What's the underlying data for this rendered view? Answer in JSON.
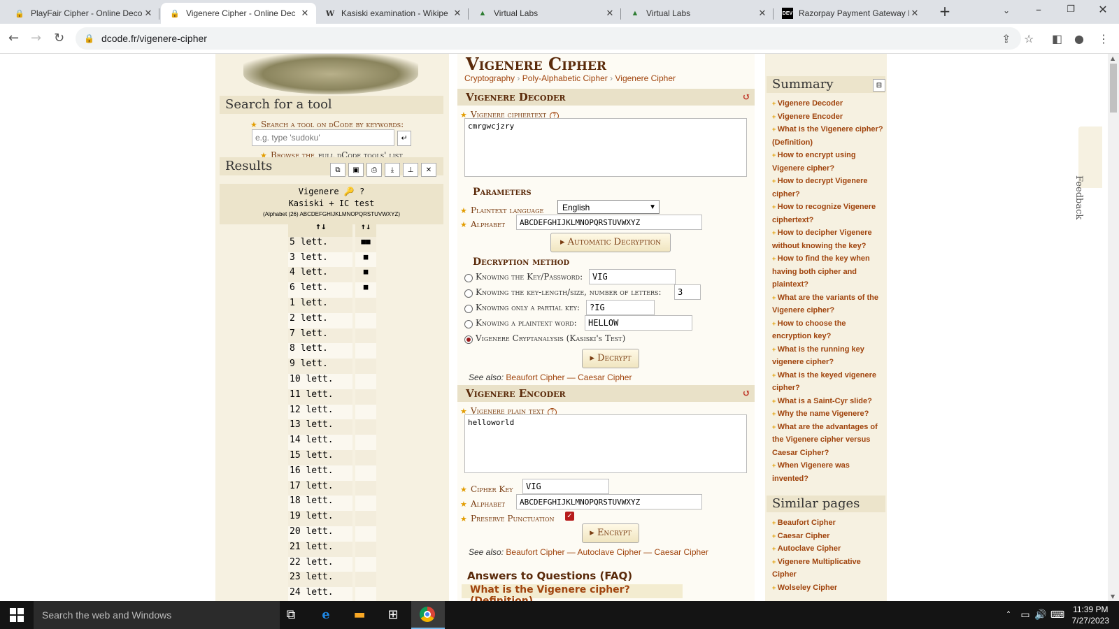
{
  "browser": {
    "tabs": [
      {
        "title": "PlayFair Cipher - Online Deco",
        "icon": "dcode-icon",
        "active": false
      },
      {
        "title": "Vigenere Cipher - Online Dec",
        "icon": "dcode-icon",
        "active": true
      },
      {
        "title": "Kasiski examination - Wikipe",
        "icon": "wikipedia-icon",
        "active": false
      },
      {
        "title": "Virtual Labs",
        "icon": "virtual-labs-icon",
        "active": false
      },
      {
        "title": "Virtual Labs",
        "icon": "virtual-labs-icon",
        "active": false
      },
      {
        "title": "Razorpay Payment Gateway I",
        "icon": "dev-icon",
        "active": false
      }
    ],
    "url": "dcode.fr/vigenere-cipher"
  },
  "left": {
    "search_heading": "Search for a tool",
    "search_label": "Search a tool on dCode by keywords:",
    "search_placeholder": "e.g. type 'sudoku'",
    "browse_text": "Browse the",
    "browse_link": "full dCode tools' list",
    "results_heading": "Results",
    "result_title": "Vigenere",
    "result_sub": "Kasiski + IC test",
    "result_alphabet": "(Alphabet (26) ABCDEFGHIJKLMNOPQRSTUVWXYZ)",
    "col1_head": "↑↓",
    "col2_head": "↑↓",
    "rows": [
      {
        "label": "5 lett.",
        "score": "■■"
      },
      {
        "label": "3 lett.",
        "score": "■"
      },
      {
        "label": "4 lett.",
        "score": "■"
      },
      {
        "label": "6 lett.",
        "score": "■"
      },
      {
        "label": "1 lett.",
        "score": ""
      },
      {
        "label": "2 lett.",
        "score": ""
      },
      {
        "label": "7 lett.",
        "score": ""
      },
      {
        "label": "8 lett.",
        "score": ""
      },
      {
        "label": "9 lett.",
        "score": ""
      },
      {
        "label": "10 lett.",
        "score": ""
      },
      {
        "label": "11 lett.",
        "score": ""
      },
      {
        "label": "12 lett.",
        "score": ""
      },
      {
        "label": "13 lett.",
        "score": ""
      },
      {
        "label": "14 lett.",
        "score": ""
      },
      {
        "label": "15 lett.",
        "score": ""
      },
      {
        "label": "16 lett.",
        "score": ""
      },
      {
        "label": "17 lett.",
        "score": ""
      },
      {
        "label": "18 lett.",
        "score": ""
      },
      {
        "label": "19 lett.",
        "score": ""
      },
      {
        "label": "20 lett.",
        "score": ""
      },
      {
        "label": "21 lett.",
        "score": ""
      },
      {
        "label": "22 lett.",
        "score": ""
      },
      {
        "label": "23 lett.",
        "score": ""
      },
      {
        "label": "24 lett.",
        "score": ""
      }
    ]
  },
  "main": {
    "title": "Vigenere Cipher",
    "breadcrumb": [
      "Cryptography",
      "Poly-Alphabetic Cipher",
      "Vigenere Cipher"
    ],
    "decoder": {
      "heading": "Vigenere Decoder",
      "ciphertext_label": "Vigenere ciphertext",
      "ciphertext": "cmrgwcjzry",
      "parameters_heading": "Parameters",
      "language_label": "Plaintext language",
      "language": "English",
      "alphabet_label": "Alphabet",
      "alphabet": "ABCDEFGHIJKLMNOPQRSTUVWXYZ",
      "auto_button": "▸ Automatic Decryption",
      "method_heading": "Decryption method",
      "methods": [
        {
          "label": "Knowing the Key/Password:",
          "value": "VIG",
          "checked": false
        },
        {
          "label": "Knowing the key-length/size, number of letters:",
          "value": "3",
          "checked": false
        },
        {
          "label": "Knowing only a partial key:",
          "value": "?IG",
          "checked": false
        },
        {
          "label": "Knowing a plaintext word:",
          "value": "HELLOW",
          "checked": false
        },
        {
          "label": "Vigenere Cryptanalysis (Kasiski's Test)",
          "value": "",
          "checked": true
        }
      ],
      "decrypt_button": "▸ Decrypt",
      "see_also_label": "See also:",
      "see_also": "Beaufort Cipher — Caesar Cipher"
    },
    "encoder": {
      "heading": "Vigenere Encoder",
      "plaintext_label": "Vigenere plain text",
      "plaintext": "helloworld",
      "key_label": "Cipher Key",
      "key": "VIG",
      "alphabet_label": "Alphabet",
      "alphabet": "ABCDEFGHIJKLMNOPQRSTUVWXYZ",
      "punct_label": "Preserve Punctuation",
      "encrypt_button": "▸ Encrypt",
      "see_also_label": "See also:",
      "see_also": "Beaufort Cipher — Autoclave Cipher — Caesar Cipher"
    },
    "faq_heading": "Answers to Questions (FAQ)",
    "faq_first": "What is the Vigenere cipher? (Definition)"
  },
  "summary": {
    "heading": "Summary",
    "items": [
      "Vigenere Decoder",
      "Vigenere Encoder",
      "What is the Vigenere cipher? (Definition)",
      "How to encrypt using Vigenere cipher?",
      "How to decrypt Vigenere cipher?",
      "How to recognize Vigenere ciphertext?",
      "How to decipher Vigenere without knowing the key?",
      "How to find the key when having both cipher and plaintext?",
      "What are the variants of the Vigenere cipher?",
      "How to choose the encryption key?",
      "What is the running key vigenere cipher?",
      "What is the keyed vigenere cipher?",
      "What is a Saint-Cyr slide?",
      "Why the name Vigenere?",
      "What are the advantages of the Vigenere cipher versus Caesar Cipher?",
      "When Vigenere was invented?"
    ],
    "similar_heading": "Similar pages",
    "similar": [
      "Beaufort Cipher",
      "Caesar Cipher",
      "Autoclave Cipher",
      "Vigenere Multiplicative Cipher",
      "Wolseley Cipher"
    ],
    "feedback": "Feedback"
  },
  "taskbar": {
    "search_placeholder": "Search the web and Windows",
    "time": "11:39 PM",
    "date": "7/27/2023"
  }
}
